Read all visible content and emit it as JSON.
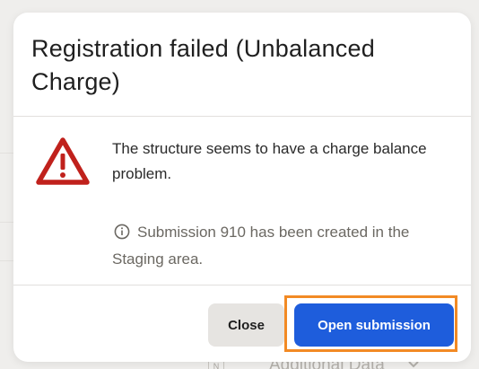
{
  "modal": {
    "title": "Registration failed (Unbalanced Charge)",
    "message": "The structure seems to have a charge balance problem.",
    "info": "Submission 910 has been created in the Staging area.",
    "icons": {
      "warning": "warning-triangle-icon",
      "info": "info-circle-icon"
    },
    "buttons": {
      "close_label": "Close",
      "open_label": "Open submission"
    }
  },
  "background": {
    "visible_text": "Additional Data",
    "chip_text": "N"
  },
  "colors": {
    "warning": "#c0211c",
    "primary": "#1e5ddc",
    "highlight": "#f28a24",
    "secondary_button": "#e6e4e1"
  }
}
